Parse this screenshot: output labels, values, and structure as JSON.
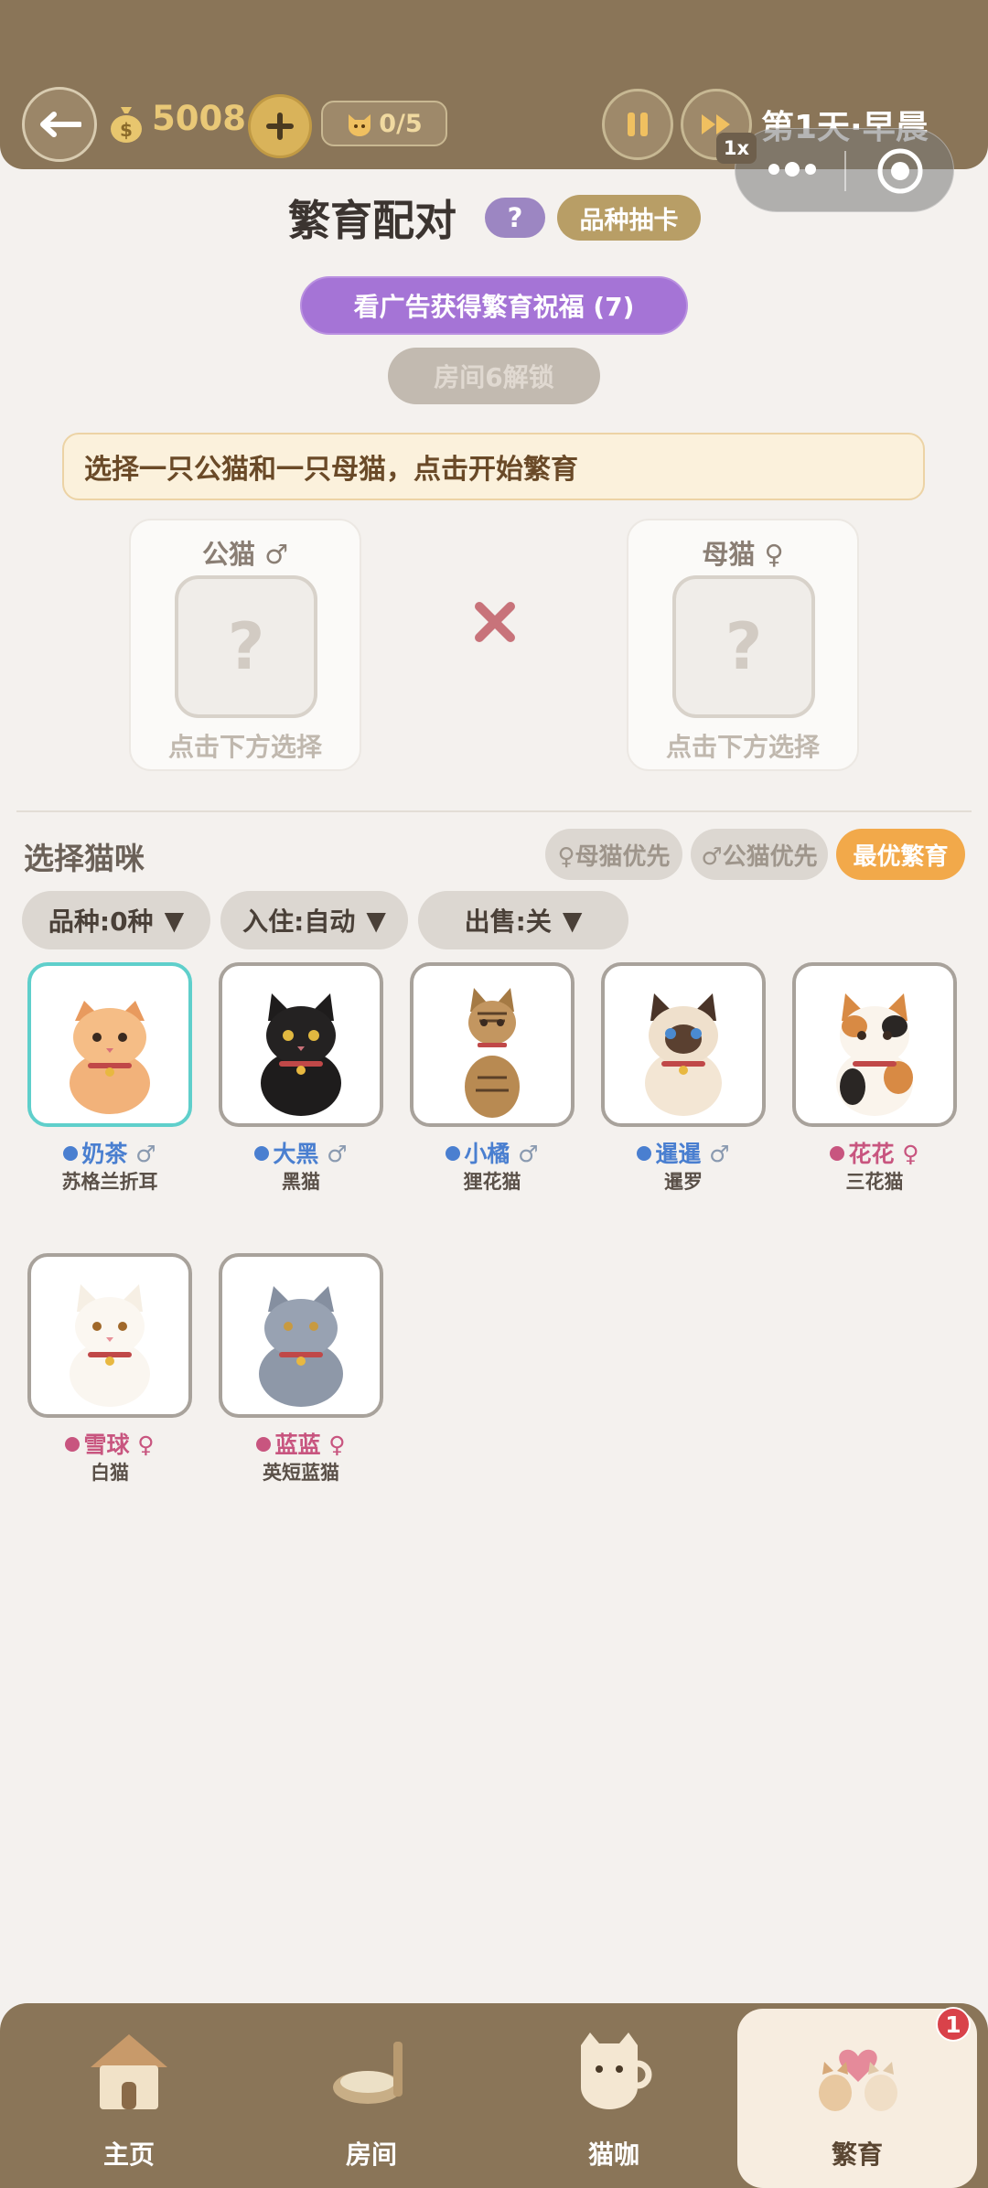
{
  "header": {
    "coins": "5008",
    "cat_count": "0/5",
    "speed": "1x",
    "day_label": "第1天·早晨"
  },
  "breeding": {
    "title": "繁育配对",
    "help_label": "?",
    "draw_card_label": "品种抽卡",
    "ad_blessing_label": "看广告获得繁育祝福 (7)",
    "room_unlock_label": "房间6解锁",
    "hint": "选择一只公猫和一只母猫，点击开始繁育",
    "male_slot": {
      "label": "公猫",
      "symbol": "♂",
      "placeholder": "?",
      "sub": "点击下方选择"
    },
    "female_slot": {
      "label": "母猫",
      "symbol": "♀",
      "placeholder": "?",
      "sub": "点击下方选择"
    }
  },
  "select": {
    "heading": "选择猫咪",
    "sort_female": "♀母猫优先",
    "sort_male": "♂公猫优先",
    "sort_best": "最优繁育",
    "filter_breed": "品种:0种",
    "filter_checkin": "入住:自动",
    "filter_sell": "出售:关",
    "filter_arrow": "▼"
  },
  "cats": [
    {
      "name": "奶茶",
      "gender": "♂",
      "breed": "苏格兰折耳"
    },
    {
      "name": "大黑",
      "gender": "♂",
      "breed": "黑猫"
    },
    {
      "name": "小橘",
      "gender": "♂",
      "breed": "狸花猫"
    },
    {
      "name": "暹暹",
      "gender": "♂",
      "breed": "暹罗"
    },
    {
      "name": "花花",
      "gender": "♀",
      "breed": "三花猫"
    },
    {
      "name": "雪球",
      "gender": "♀",
      "breed": "白猫"
    },
    {
      "name": "蓝蓝",
      "gender": "♀",
      "breed": "英短蓝猫"
    }
  ],
  "tabs": [
    {
      "label": "主页",
      "icon": "house-icon"
    },
    {
      "label": "房间",
      "icon": "room-icon"
    },
    {
      "label": "猫咖",
      "icon": "cat-cup-icon"
    },
    {
      "label": "繁育",
      "icon": "breeding-icon"
    }
  ],
  "tab_badge": "1",
  "colors": {
    "header": "#8a7558",
    "male": "#4a7fd0",
    "female": "#c8557f",
    "accent_purple": "#a574d6",
    "accent_orange": "#f2a94a"
  }
}
